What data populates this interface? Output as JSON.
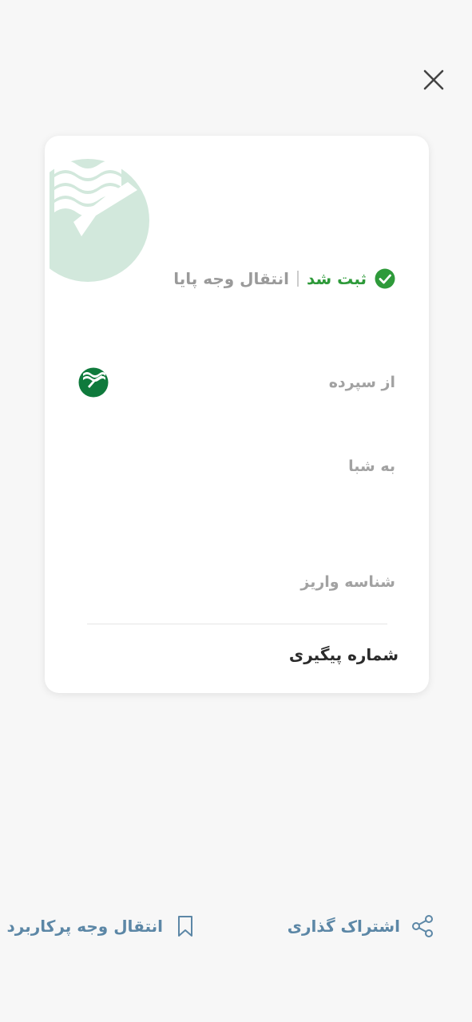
{
  "header": {
    "close_icon": "close-icon"
  },
  "receipt": {
    "status_icon": "check-circle-icon",
    "status_text": "ثبت شد",
    "title": "انتقال وجه پایا",
    "bank_watermark": "bank-logo-watermark",
    "fields": {
      "from_label": "از سپرده",
      "to_label": "به شبا",
      "deposit_id_label": "شناسه واریز"
    },
    "bank_icon": "bank-logo-icon",
    "tracking_label": "شماره پیگیری"
  },
  "actions": {
    "share_label": "اشتراک گذاری",
    "share_icon": "share-icon",
    "favorite_label": "انتقال وجه پرکاربرد",
    "favorite_icon": "bookmark-icon"
  },
  "colors": {
    "success": "#2e9a3a",
    "action": "#5c87a6",
    "bank_green": "#0f7a3c",
    "watermark": "#d2e8dc"
  }
}
